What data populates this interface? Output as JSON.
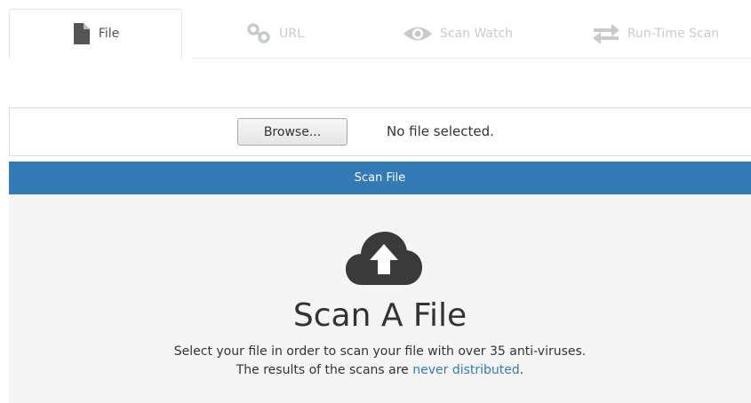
{
  "tabs": [
    {
      "label": "File",
      "icon": "file-icon",
      "active": true
    },
    {
      "label": "URL",
      "icon": "link-icon",
      "active": false
    },
    {
      "label": "Scan Watch",
      "icon": "eye-icon",
      "active": false
    },
    {
      "label": "Run-Time Scan",
      "icon": "swap-arrows-icon",
      "active": false
    }
  ],
  "upload": {
    "browse_label": "Browse...",
    "file_status": "No file selected."
  },
  "scan_button_label": "Scan File",
  "dropzone": {
    "icon": "cloud-upload-icon",
    "heading": "Scan A File",
    "line1": "Select your file in order to scan your file with over 35 anti-viruses.",
    "line2_prefix": "The results of the scans are",
    "line2_link": "never distributed",
    "line2_suffix": "."
  },
  "colors": {
    "accent": "#337ab7",
    "inactive_tab": "#c7cbd0",
    "dropzone_bg": "#f5f5f5"
  }
}
